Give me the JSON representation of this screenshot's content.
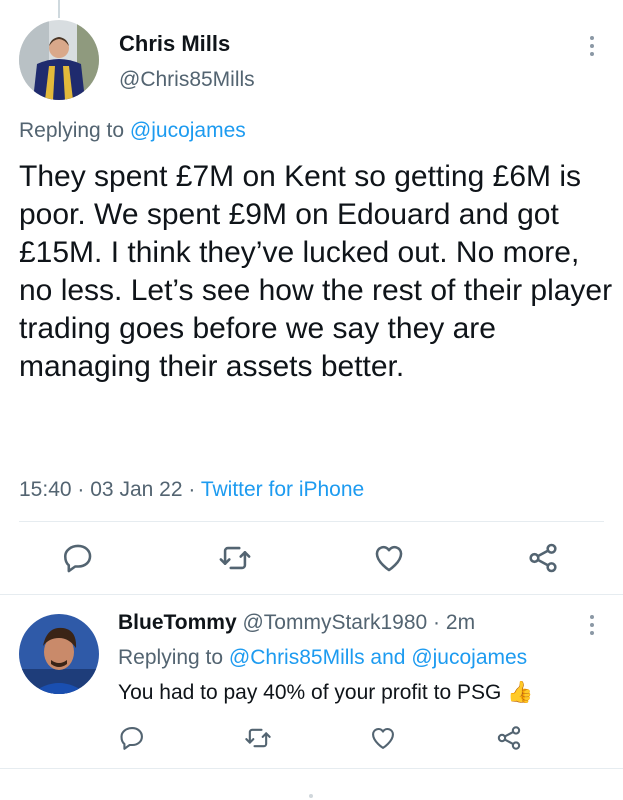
{
  "main_tweet": {
    "author_name": "Chris Mills",
    "author_handle": "@Chris85Mills",
    "replying_to_label": "Replying to",
    "replying_to_handle": "@jucojames",
    "text": "They spent £7M on Kent so getting £6M is poor. We spent £9M on Edouard and got £15M. I think they’ve lucked out. No more, no less. Let’s see how the rest of their player trading goes before we say they are managing their assets better.",
    "time": "15:40",
    "date": "03 Jan 22",
    "separator": "·",
    "source": "Twitter for iPhone"
  },
  "reply_tweet": {
    "author_name": "BlueTommy",
    "author_handle": "@TommyStark1980",
    "separator": "·",
    "age": "2m",
    "replying_to_label": "Replying to",
    "replying_to_handle1": "@Chris85Mills",
    "and_label": "and",
    "replying_to_handle2": "@jucojames",
    "text": "You had to pay 40% of your profit to PSG",
    "emoji": "👍"
  },
  "icons": {
    "reply": "reply-icon",
    "retweet": "retweet-icon",
    "like": "heart-icon",
    "share": "share-icon",
    "more": "more-options-icon"
  },
  "colors": {
    "link": "#1d9bf0",
    "secondary_text": "#536471",
    "primary_text": "#0f1419",
    "divider": "#e6ecf0",
    "icon": "#536471"
  }
}
